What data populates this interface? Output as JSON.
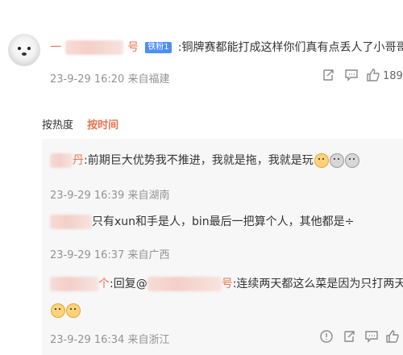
{
  "comment": {
    "prefix": "一",
    "name_tail": "号",
    "badge": "铁粉1",
    "text": ":铜牌赛都能打成这样你们真有点丢人了小哥哥们",
    "meta": "23-9-29 16:20 来自福建",
    "like_count": "189"
  },
  "tabs": {
    "hot": "按热度",
    "time": "按时间"
  },
  "replies": [
    {
      "name_tail": "丹",
      "text": ":前期巨大优势我不推进，我就是拖，我就是玩",
      "meta": "23-9-29 16:39 来自湖南"
    },
    {
      "name_tail": "",
      "text": "只有xun和手是人，bin最后一把算个人，其他都是÷",
      "meta": "23-9-29 16:37 来自广西"
    },
    {
      "name_tail": "个",
      "reply_prefix": ":回复@",
      "reply_target_tail": "号",
      "text": ":连续两天都这么菜是因为只打两天",
      "meta": "23-9-29 16:34 来自浙江"
    }
  ],
  "icons": [
    "avatar",
    "repost-icon",
    "comment-icon",
    "like-icon",
    "report-icon",
    "cry-emoji",
    "face-emoji"
  ]
}
